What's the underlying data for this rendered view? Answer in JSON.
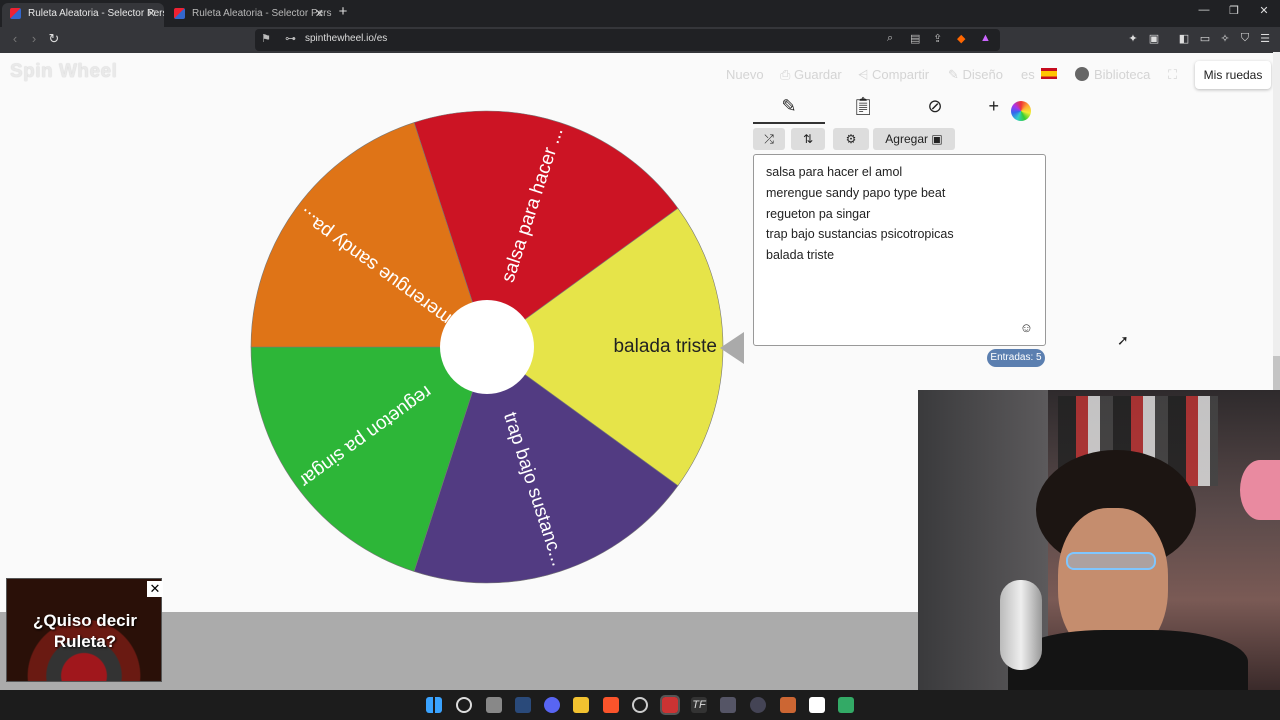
{
  "browser": {
    "tabs": [
      {
        "title": "Ruleta Aleatoria - Selector Perso",
        "active": true
      },
      {
        "title": "Ruleta Aleatoria - Selector Personaliz",
        "active": false
      }
    ],
    "url": "spinthewheel.io/es"
  },
  "header": {
    "logo": "Spin Wheel",
    "menu": {
      "nuevo": "Nuevo",
      "guardar": "Guardar",
      "compartir": "Compartir",
      "diseno": "Diseño",
      "lang": "es",
      "biblioteca": "Biblioteca"
    },
    "mis_ruedas": "Mis ruedas"
  },
  "wheel": {
    "segments": [
      {
        "label": "salsa para hacer ...",
        "color": "#cc1424"
      },
      {
        "label": "balada triste",
        "color": "#e6e449"
      },
      {
        "label": "trap bajo sustanc...",
        "color": "#523b82"
      },
      {
        "label": "regueton pa singar",
        "color": "#2db638"
      },
      {
        "label": "merengue sandy pa...",
        "color": "#df7417"
      }
    ]
  },
  "editor": {
    "add_button": "Agregar",
    "entries": [
      "salsa para hacer el amol",
      "merengue sandy papo type beat",
      "regueton pa singar",
      "trap bajo sustancias psicotropicas",
      "balada triste"
    ],
    "entries_count_label": "Entradas: 5"
  },
  "ad": {
    "line1": "¿Quiso decir",
    "line2": "Ruleta?",
    "close": "✕"
  }
}
